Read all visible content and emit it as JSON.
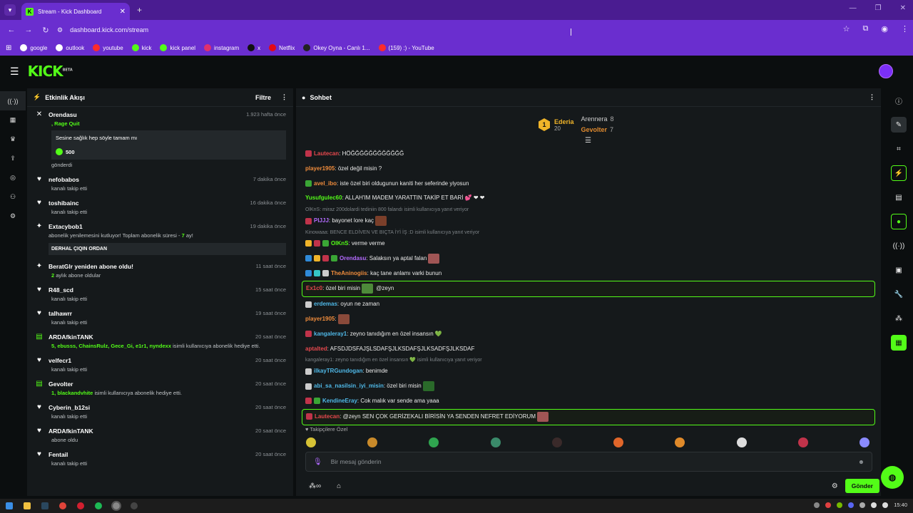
{
  "browser": {
    "tab_title": "Stream - Kick Dashboard",
    "tab_close": "✕",
    "new_tab": "+",
    "url": "dashboard.kick.com/stream",
    "window_controls": [
      "—",
      "❐",
      "✕"
    ],
    "bookmarks": [
      {
        "label": "google",
        "color": "#ffffff"
      },
      {
        "label": "outlook",
        "color": "#ffffff"
      },
      {
        "label": "youtube",
        "color": "#ff2b2b"
      },
      {
        "label": "kick",
        "color": "#53fc18"
      },
      {
        "label": "kick panel",
        "color": "#53fc18"
      },
      {
        "label": "instagram",
        "color": "#e1306c"
      },
      {
        "label": "x",
        "color": "#111111"
      },
      {
        "label": "Netflix",
        "color": "#e50914"
      },
      {
        "label": "Okey Oyna - Canlı 1...",
        "color": "#222222"
      },
      {
        "label": "(159) :) - YouTube",
        "color": "#ff2b2b"
      }
    ]
  },
  "site": {
    "logo": "KICK",
    "logo_sup": "BETA"
  },
  "activity": {
    "title": "Etkinlik Akışı",
    "filter": "Filtre",
    "events": [
      {
        "type": "gift",
        "icon": "✕",
        "name": "Orendasu",
        "time": "1.923 hafta önce",
        "sub": ", Rage Quit",
        "message": "Sesine sağlık hep söyle tamam mı",
        "amount": "500",
        "footer": "gönderdi"
      },
      {
        "type": "follow",
        "icon": "♥",
        "name": "nefobabos",
        "time": "7 dakika önce",
        "sub": "kanalı takip etti"
      },
      {
        "type": "follow",
        "icon": "♥",
        "name": "toshibainc",
        "time": "16 dakika önce",
        "sub": "kanalı takip etti"
      },
      {
        "type": "resub",
        "icon": "✦",
        "name": "Extacybob1",
        "time": "19 dakika önce",
        "sub_a": "abonelik yenilemesini kutluyor! Toplam abonelik süresi - ",
        "sub_b": "7",
        "sub_c": " ay!",
        "message": "DERHAL ÇIQIN ORDAN"
      },
      {
        "type": "resub2",
        "icon": "✦",
        "name": "BeratGlr yeniden abone oldu!",
        "time": "11 saat önce",
        "sub_a": "2",
        "sub_b": " aylık abone oldular"
      },
      {
        "type": "follow",
        "icon": "♥",
        "name": "R48_scd",
        "time": "15 saat önce",
        "sub": "kanalı takip etti"
      },
      {
        "type": "follow",
        "icon": "♥",
        "name": "talhawrr",
        "time": "19 saat önce",
        "sub": "kanalı takip etti"
      },
      {
        "type": "giftsub",
        "icon": "▤",
        "name": "ARDAfkinTANK",
        "time": "20 saat önce",
        "sub_a": "5, ebusss, ChainsRulz, Gece_Gi, e1r1, nyndexx",
        "sub_b": " isimli kullanıcıya abonelik hediye etti."
      },
      {
        "type": "follow",
        "icon": "♥",
        "name": "velfecr1",
        "time": "20 saat önce",
        "sub": "kanalı takip etti"
      },
      {
        "type": "giftsub",
        "icon": "▤",
        "name": "Gevolter",
        "time": "20 saat önce",
        "sub_a": "1, blackandvhite",
        "sub_b": " isimli kullanıcıya abonelik hediye etti."
      },
      {
        "type": "follow",
        "icon": "♥",
        "name": "Cyberin_b12si",
        "time": "20 saat önce",
        "sub": "kanalı takip etti"
      },
      {
        "type": "follow",
        "icon": "♥",
        "name": "ARDAfkinTANK",
        "time": "20 saat önce",
        "sub": "abone oldu"
      },
      {
        "type": "follow",
        "icon": "♥",
        "name": "Fentail",
        "time": "20 saat önce",
        "sub": "kanalı takip etti"
      }
    ]
  },
  "chat": {
    "title": "Sohbet",
    "leaderboard": {
      "first": {
        "rank": "1",
        "name": "Ederia",
        "count": "20"
      },
      "second": {
        "name": "Arennera",
        "count": "8"
      },
      "third": {
        "name": "Gevolter",
        "count": "7"
      }
    },
    "messages": [
      {
        "user": "Lautecan",
        "color": "#e5484d",
        "badges": [
          "#c0334a"
        ],
        "text": ": HÖĞĞĞĞĞĞĞĞĞĞĞĞ"
      },
      {
        "user": "player1905",
        "color": "#f08c3c",
        "badges": [],
        "text": ": özel değil misin ?"
      },
      {
        "user": "avel_ibo",
        "color": "#f08c3c",
        "badges": [
          "#3aa635"
        ],
        "text": ": iste özel biri oldugunun kaniti her seferinde yiyosun"
      },
      {
        "user": "Yusufgulec60",
        "color": "#53fc18",
        "badges": [],
        "text": ": ALLAH'IM MADEM YARATTIN TAKİP ET BARİ 💕 ❤ ❤"
      },
      {
        "reply": "OlKnS: miraz 200dolardi tediniin 800 falandı isimli kullanıcıya yanıt veriyor"
      },
      {
        "user": "PIJJJ",
        "color": "#b46bff",
        "badges": [
          "#c0334a"
        ],
        "text": ": bayonet lore kaç",
        "emote": "#7b3f2a"
      },
      {
        "reply": "Kinowaaa: BENCE ELDİVEN VE BIÇTA İYİ İŞ :D isimli kullanıcıya yanıt veriyor"
      },
      {
        "user": "OlKnS",
        "color": "#53fc18",
        "badges": [
          "#f0b429",
          "#c0334a",
          "#3aa635"
        ],
        "text": ": verme verme"
      },
      {
        "user": "Orendasu",
        "color": "#b46bff",
        "badges": [
          "#2f8ad8",
          "#f0b429",
          "#c0334a",
          "#3aa635"
        ],
        "text": ": Salaksın ya aptal falan",
        "emote": "#a05555"
      },
      {
        "user": "TheAninogiis",
        "color": "#f08c3c",
        "badges": [
          "#2f8ad8",
          "#35c6c6",
          "#cccccc"
        ],
        "text": ": kaç tane anlamı varki bunun"
      },
      {
        "user": "Ex1c0",
        "color": "#e5484d",
        "badges": [],
        "text": ": özel biri misin",
        "emote": "#4e8a3a",
        "tail": " @zeyn",
        "hl": true
      },
      {
        "user": "erdemas",
        "color": "#4fb9e8",
        "badges": [
          "#cccccc"
        ],
        "text": ": oyun ne zaman"
      },
      {
        "user": "player1905",
        "color": "#f08c3c",
        "badges": [],
        "text": ":",
        "emote": "#8a4a3a"
      },
      {
        "user": "kangaleray1",
        "color": "#4fb9e8",
        "badges": [
          "#c0334a"
        ],
        "text": ": zeyno tanıdığım en özel insansın 💚"
      },
      {
        "user": "aptalted",
        "color": "#e5484d",
        "badges": [],
        "text": ": AFSDJDSFAJŞLSDAFŞJLKSDAFŞJLKSADFŞJLKSDAF"
      },
      {
        "reply": "kangaleray1: zeyno tanıdığım en özel insansın 💚 isimli kullanıcıya yanıt veriyor"
      },
      {
        "user": "ilkayTRGundogan",
        "color": "#4fb9e8",
        "badges": [
          "#cccccc"
        ],
        "text": ": benimde"
      },
      {
        "user": "abi_sa_nasilsin_iyi_misin",
        "color": "#4fb9e8",
        "badges": [
          "#cccccc"
        ],
        "text": ": özel biri misin",
        "emote": "#2a6a2a"
      },
      {
        "user": "KendineEray",
        "color": "#4fb9e8",
        "badges": [
          "#c0334a",
          "#3aa635"
        ],
        "text": ": Cok malık var sende ama yaaa"
      },
      {
        "user": "Lautecan",
        "color": "#e5484d",
        "badges": [
          "#c0334a"
        ],
        "text": ": @zeyn SEN ÇOK GERİZEKALI BİRİSİN YA SENDEN NEFRET EDİYORUM",
        "emote": "#a05555",
        "hl": true
      }
    ],
    "subs_only": "♥ Takipçilere Özel",
    "emotebar": [
      "#d6c235",
      "#c98a2a",
      "#2fa44f",
      "#3a8a6a",
      "#3a2a2a",
      "#e0662a",
      "#e08a2a",
      "#dddddd",
      "#c0334a",
      "#8a8aff"
    ],
    "input_placeholder": "Bir mesaj gönderin",
    "send": "Gönder"
  },
  "taskbar": {
    "time": "15:40"
  }
}
